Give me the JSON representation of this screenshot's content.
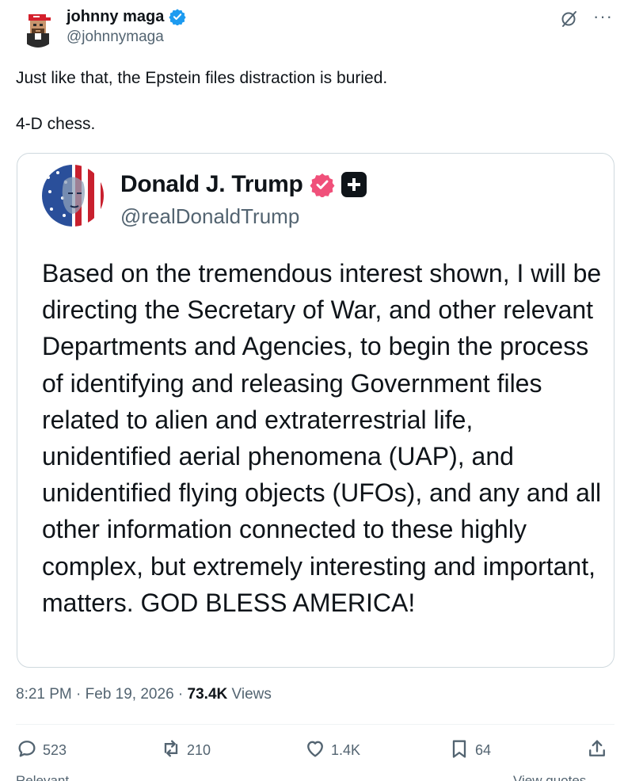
{
  "author": {
    "display_name": "johnny maga",
    "handle": "@johnnymaga",
    "verified": true,
    "badge_color": "#1d9bf0"
  },
  "tweet_text": "Just like that, the Epstein files distraction is buried.\n\n4-D chess.",
  "quoted": {
    "display_name": "Donald J. Trump",
    "handle": "@realDonaldTrump",
    "badge_color": "#f0507a",
    "text": "Based on the tremendous interest shown, I will be directing the Secretary of War, and other relevant Departments and Agencies, to begin the process of identifying and releasing Government files related to alien and extraterrestrial life, unidentified aerial phenomena (UAP), and unidentified flying objects (UFOs), and any and all other information connected to these highly complex, but extremely interesting and important, matters. GOD BLESS AMERICA!"
  },
  "meta": {
    "time": "8:21 PM",
    "separator": "·",
    "date": "Feb 19, 2026",
    "views_count": "73.4K",
    "views_label": "Views"
  },
  "actions": {
    "replies": "523",
    "reposts": "210",
    "likes": "1.4K",
    "bookmarks": "64"
  },
  "footer": {
    "relevant": "Relevant",
    "view_quotes": "View quotes"
  },
  "icons": {
    "top_right": [
      "grok-icon",
      "more-icon"
    ],
    "actions": [
      "reply-icon",
      "repost-icon",
      "like-icon",
      "bookmark-icon",
      "share-icon"
    ]
  }
}
